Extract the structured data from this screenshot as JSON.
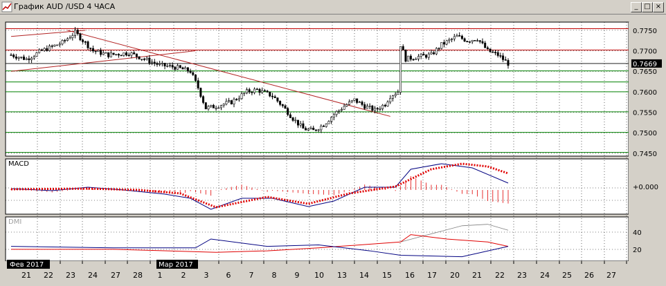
{
  "window": {
    "title": "График AUD /USD  4 ЧАСА",
    "buttons": {
      "minimize": "_",
      "maximize": "□",
      "close": "×"
    }
  },
  "colors": {
    "background": "#ffffff",
    "grid": "#000000",
    "candle": "#000000",
    "trendline": "#b22222",
    "hline_red": "#c00000",
    "hline_green": "#008000",
    "macd_line": "#000080",
    "macd_signal": "#e00000",
    "macd_hist": "#e00000",
    "dmi_plus": "#000080",
    "dmi_minus": "#e00000",
    "adx": "#808080"
  },
  "price_panel": {
    "y_ticks": [
      "0.7750",
      "0.7700",
      "0.7650",
      "0.7600",
      "0.7550",
      "0.7500",
      "0.7450"
    ],
    "current_price": "0.7669",
    "ylim": [
      0.7443,
      0.777
    ]
  },
  "macd_panel": {
    "label": "MACD",
    "zero_label": "+0.000"
  },
  "dmi_panel": {
    "label": "DMI",
    "y_ticks": [
      "40",
      "20"
    ]
  },
  "x_axis": {
    "labels": [
      "21",
      "22",
      "23",
      "24",
      "27",
      "28",
      "1",
      "2",
      "3",
      "6",
      "7",
      "8",
      "9",
      "10",
      "13",
      "14",
      "15",
      "16",
      "17",
      "20",
      "21",
      "22",
      "23",
      "24",
      "25",
      "26",
      "27"
    ],
    "month_badges": [
      "Фев 2017",
      "Мар 2017"
    ]
  },
  "chart_data": {
    "type": "candlestick",
    "symbol": "AUD/USD",
    "timeframe": "4h",
    "ylim": [
      0.7443,
      0.777
    ],
    "current_price": 0.7669,
    "horizontal_lines": {
      "red": [
        0.7754,
        0.7702
      ],
      "green": [
        0.7651,
        0.7624,
        0.76,
        0.7551,
        0.7501,
        0.7452
      ]
    },
    "close_path": [
      [
        0,
        0.769
      ],
      [
        6,
        0.768
      ],
      [
        12,
        0.77
      ],
      [
        20,
        0.772
      ],
      [
        25,
        0.7745
      ],
      [
        32,
        0.77
      ],
      [
        38,
        0.769
      ],
      [
        46,
        0.7695
      ],
      [
        52,
        0.768
      ],
      [
        58,
        0.7665
      ],
      [
        64,
        0.766
      ],
      [
        70,
        0.765
      ],
      [
        73,
        0.761
      ],
      [
        76,
        0.756
      ],
      [
        80,
        0.7565
      ],
      [
        86,
        0.7575
      ],
      [
        92,
        0.76
      ],
      [
        96,
        0.7605
      ],
      [
        102,
        0.759
      ],
      [
        106,
        0.7565
      ],
      [
        110,
        0.7535
      ],
      [
        114,
        0.751
      ],
      [
        118,
        0.7505
      ],
      [
        122,
        0.752
      ],
      [
        126,
        0.7545
      ],
      [
        130,
        0.7565
      ],
      [
        134,
        0.758
      ],
      [
        138,
        0.7565
      ],
      [
        142,
        0.7555
      ],
      [
        146,
        0.757
      ],
      [
        148,
        0.759
      ],
      [
        151,
        0.76
      ],
      [
        152,
        0.7715
      ],
      [
        154,
        0.768
      ],
      [
        158,
        0.7685
      ],
      [
        164,
        0.769
      ],
      [
        168,
        0.7715
      ],
      [
        174,
        0.7735
      ],
      [
        178,
        0.7725
      ],
      [
        182,
        0.773
      ],
      [
        186,
        0.77
      ],
      [
        190,
        0.769
      ],
      [
        194,
        0.7669
      ]
    ],
    "bar_count": 195,
    "trendlines": [
      {
        "from": [
          0,
          0.7735
        ],
        "to": [
          29,
          0.775
        ]
      },
      {
        "from": [
          0,
          0.765
        ],
        "to": [
          72,
          0.77
        ]
      },
      {
        "from": [
          22,
          0.775
        ],
        "to": [
          148,
          0.754
        ]
      }
    ],
    "macd": {
      "line": [
        [
          0,
          0.0002
        ],
        [
          16,
          -0.0001
        ],
        [
          30,
          0.0004
        ],
        [
          44,
          0.0
        ],
        [
          60,
          -0.0006
        ],
        [
          70,
          -0.0012
        ],
        [
          78,
          -0.0028
        ],
        [
          90,
          -0.0012
        ],
        [
          102,
          -0.0012
        ],
        [
          116,
          -0.0024
        ],
        [
          126,
          -0.0016
        ],
        [
          138,
          0.0004
        ],
        [
          150,
          0.0004
        ],
        [
          156,
          0.003
        ],
        [
          168,
          0.0038
        ],
        [
          180,
          0.0032
        ],
        [
          194,
          0.001
        ]
      ],
      "signal": [
        [
          0,
          0.0001
        ],
        [
          30,
          0.0002
        ],
        [
          50,
          0.0
        ],
        [
          66,
          -0.0005
        ],
        [
          80,
          -0.0025
        ],
        [
          100,
          -0.001
        ],
        [
          116,
          -0.002
        ],
        [
          132,
          -0.0005
        ],
        [
          150,
          0.0005
        ],
        [
          164,
          0.003
        ],
        [
          176,
          0.0038
        ],
        [
          186,
          0.0034
        ],
        [
          194,
          0.0024
        ]
      ]
    },
    "dmi": {
      "plus_di": [
        [
          0,
          20
        ],
        [
          40,
          18
        ],
        [
          72,
          18
        ],
        [
          78,
          30
        ],
        [
          100,
          20
        ],
        [
          120,
          22
        ],
        [
          140,
          14
        ],
        [
          152,
          8
        ],
        [
          176,
          6
        ],
        [
          194,
          20
        ]
      ],
      "minus_di": [
        [
          0,
          16
        ],
        [
          40,
          16
        ],
        [
          80,
          12
        ],
        [
          100,
          14
        ],
        [
          120,
          18
        ],
        [
          152,
          26
        ],
        [
          156,
          36
        ],
        [
          170,
          30
        ],
        [
          186,
          26
        ],
        [
          194,
          20
        ]
      ],
      "adx": [
        [
          152,
          26
        ],
        [
          176,
          48
        ],
        [
          186,
          50
        ],
        [
          194,
          42
        ]
      ]
    }
  }
}
